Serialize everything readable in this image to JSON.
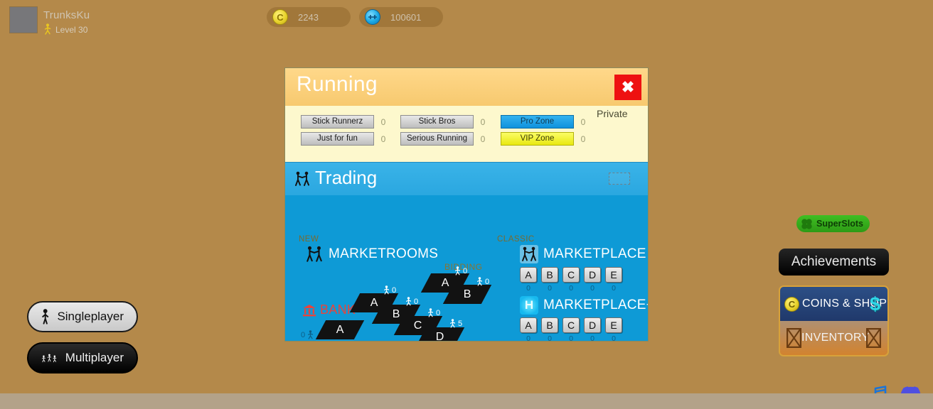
{
  "topbar": {
    "player_name": "TrunksKu",
    "level_text": "Level 30",
    "avatar_name": "avatar-placeholder",
    "coins": {
      "icon": "coin-icon",
      "symbol": "C",
      "value": "2243"
    },
    "gems": {
      "icon": "gem-icon",
      "symbol": "",
      "value": "100601"
    }
  },
  "dialog": {
    "title": "Running",
    "close_label": "✖",
    "private_label": "Private",
    "rooms": [
      {
        "label": "Stick Runnerz",
        "count": "0",
        "style": "gray"
      },
      {
        "label": "Just for fun",
        "count": "0",
        "style": "gray"
      },
      {
        "label": "Stick Bros",
        "count": "0",
        "style": "gray"
      },
      {
        "label": "Serious Running",
        "count": "0",
        "style": "gray"
      },
      {
        "label": "Pro Zone",
        "count": "0",
        "style": "blue"
      },
      {
        "label": "VIP Zone",
        "count": "0",
        "style": "yellow"
      }
    ]
  },
  "trading": {
    "title": "Trading",
    "icon": "two-figures-icon",
    "new_label": "NEW",
    "classic_label": "CLASSIC",
    "marketrooms_label": "MARKETROOMS",
    "marketplace_label": "MARKETPLACE",
    "marketplace_plus_label": "MARKETPLACE+",
    "marketplace_plus_icon": "H",
    "bidding_label": "BIDDING",
    "bank_label": "BANK",
    "marketplace_keys": [
      "A",
      "B",
      "C",
      "D",
      "E"
    ],
    "marketplace_counts": [
      "0",
      "0",
      "0",
      "0",
      "0"
    ],
    "marketplace_plus_keys": [
      "A",
      "B",
      "C",
      "D",
      "E"
    ],
    "marketplace_plus_counts": [
      "0",
      "0",
      "0",
      "0",
      "0"
    ],
    "bank_tiles": [
      {
        "label": "A",
        "count": "0"
      }
    ],
    "main_tiles": [
      {
        "label": "A",
        "count": "0"
      },
      {
        "label": "B",
        "count": "0"
      },
      {
        "label": "C",
        "count": "0"
      },
      {
        "label": "D",
        "count": "5"
      }
    ],
    "bidding_tiles": [
      {
        "label": "A",
        "count": "0"
      },
      {
        "label": "B",
        "count": "0"
      }
    ]
  },
  "left_menu": {
    "singleplayer_label": "Singleplayer",
    "multiplayer_label": "Multiplayer"
  },
  "right_menu": {
    "superslots_label": "SuperSlots",
    "achievements_label": "Achievements",
    "coins_shop_label": "COINS & SHOP",
    "coins_shop_symbol": "C",
    "coins_shop_currency": "$",
    "inventory_label": "INVENTORY"
  },
  "bottom_icons": {
    "music_label": "music-note-icon",
    "discord_label": "discord-icon"
  },
  "colors": {
    "background": "#b4894a",
    "dialog_header": "#f7c96f",
    "trading_blue": "#0e9ad6",
    "close_red": "#ee1111",
    "bank_red": "#e8443c",
    "accent_green": "#2d9a16"
  }
}
